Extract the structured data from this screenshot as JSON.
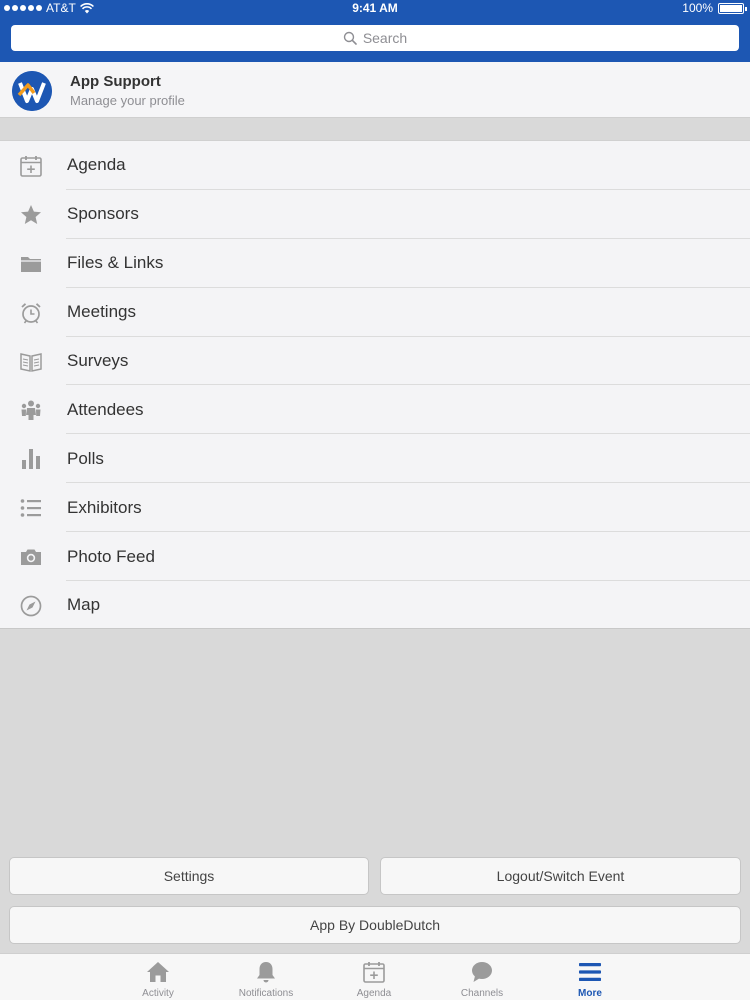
{
  "status": {
    "carrier": "AT&T",
    "time": "9:41 AM",
    "battery": "100%"
  },
  "search": {
    "placeholder": "Search"
  },
  "profile": {
    "name": "App Support",
    "subtitle": "Manage your profile"
  },
  "menu": {
    "items": [
      {
        "label": "Agenda",
        "icon": "calendar-add-icon"
      },
      {
        "label": "Sponsors",
        "icon": "star-icon"
      },
      {
        "label": "Files & Links",
        "icon": "folder-icon"
      },
      {
        "label": "Meetings",
        "icon": "alarm-clock-icon"
      },
      {
        "label": "Surveys",
        "icon": "book-icon"
      },
      {
        "label": "Attendees",
        "icon": "people-icon"
      },
      {
        "label": "Polls",
        "icon": "bar-chart-icon"
      },
      {
        "label": "Exhibitors",
        "icon": "list-icon"
      },
      {
        "label": "Photo Feed",
        "icon": "camera-icon"
      },
      {
        "label": "Map",
        "icon": "compass-icon"
      }
    ]
  },
  "buttons": {
    "settings": "Settings",
    "logout": "Logout/Switch Event",
    "app_by": "App By DoubleDutch"
  },
  "tabs": [
    {
      "label": "Activity",
      "icon": "home-icon"
    },
    {
      "label": "Notifications",
      "icon": "bell-icon"
    },
    {
      "label": "Agenda",
      "icon": "calendar-add-icon"
    },
    {
      "label": "Channels",
      "icon": "chat-bubble-icon"
    },
    {
      "label": "More",
      "icon": "menu-icon",
      "active": true
    }
  ],
  "colors": {
    "brand": "#1d57b3",
    "icon_gray": "#9b9b9b",
    "active_tab": "#1d57b3"
  }
}
